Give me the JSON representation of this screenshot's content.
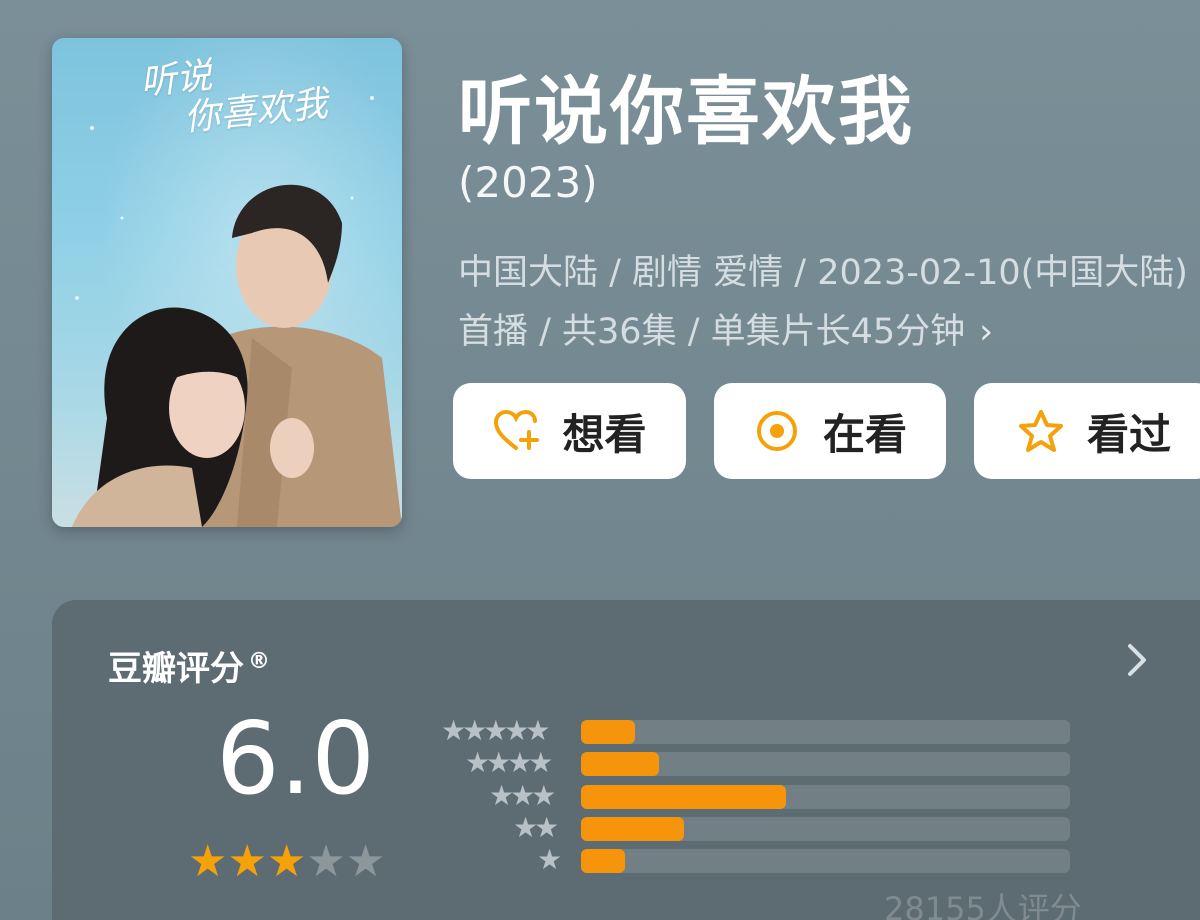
{
  "poster": {
    "title_line1": "听说",
    "title_line2": "你喜欢我"
  },
  "show": {
    "title": "听说你喜欢我",
    "year": "(2023)",
    "meta": "中国大陆 / 剧情 爱情 / 2023-02-10(中国大陆)首播 / 共36集 / 单集片长45分钟",
    "meta_chevron": "›"
  },
  "actions": [
    {
      "label": "想看",
      "icon": "heart-plus-icon"
    },
    {
      "label": "在看",
      "icon": "target-icon"
    },
    {
      "label": "看过",
      "icon": "star-outline-icon"
    }
  ],
  "rating": {
    "title": "豆瓣评分",
    "registered": "®",
    "score": "6.0",
    "stars": 3,
    "max_stars": 5,
    "distribution": [
      {
        "stars": 5,
        "fraction": 0.11
      },
      {
        "stars": 4,
        "fraction": 0.16
      },
      {
        "stars": 3,
        "fraction": 0.42
      },
      {
        "stars": 2,
        "fraction": 0.21
      },
      {
        "stars": 1,
        "fraction": 0.09
      }
    ],
    "count": "28155人评分"
  },
  "colors": {
    "accent": "#f6950b",
    "card": "#5d6b72",
    "background": "#72868f"
  }
}
